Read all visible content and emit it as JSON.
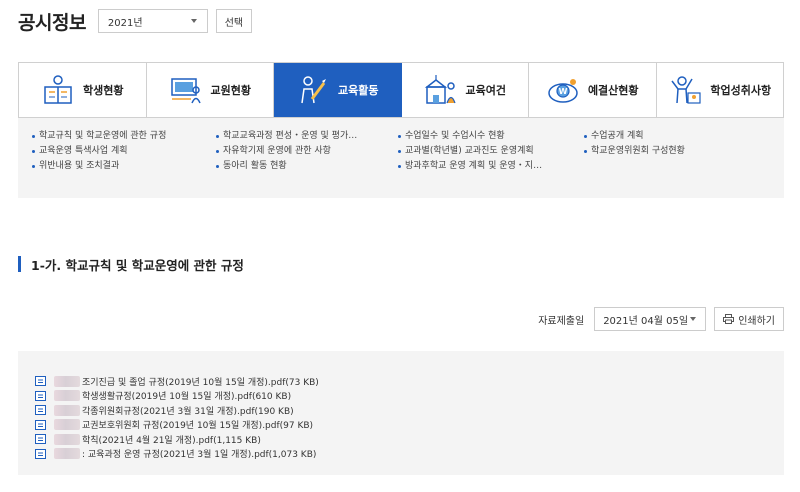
{
  "header": {
    "title": "공시정보",
    "year": "2021년",
    "select_button": "선택"
  },
  "tabs": [
    {
      "label": "학생현황",
      "icon": "students-icon",
      "active": false
    },
    {
      "label": "교원현황",
      "icon": "teacher-board-icon",
      "active": false
    },
    {
      "label": "교육활동",
      "icon": "activity-pencil-icon",
      "active": true
    },
    {
      "label": "교육여건",
      "icon": "school-building-icon",
      "active": false
    },
    {
      "label": "예결산현황",
      "icon": "budget-coin-icon",
      "active": false
    },
    {
      "label": "학업성취사항",
      "icon": "achievement-trophy-icon",
      "active": false
    }
  ],
  "submenu": {
    "col1": [
      "학교규칙 및 학교운영에 관한 규정",
      "교육운영 특색사업 계획",
      "위반내용 및 조치결과"
    ],
    "col2": [
      "학교교육과정 편성・운영 및 평가…",
      "자유학기제 운영에 관한 사항",
      "동아리 활동 현황"
    ],
    "col3": [
      "수업일수 및 수업시수 현황",
      "교과별(학년별) 교과진도 운영계획",
      "방과후학교 운영 계획 및 운영・지…"
    ],
    "col4": [
      "수업공개 계획",
      "학교운영위원회 구성현황"
    ]
  },
  "section": {
    "title": "1-가. 학교규칙 및 학교운영에 관한 규정",
    "date_label": "자료제출일",
    "date_value": "2021년 04월 05일",
    "print_label": "인쇄하기"
  },
  "files": [
    "조기진급 및 졸업 규정(2019년 10월 15일 개정).pdf(73 KB)",
    "학생생활규정(2019년 10월 15일 개정).pdf(610 KB)",
    "각종위원회규정(2021년 3월 31일 개정).pdf(190 KB)",
    "교권보호위원회 규정(2019년 10월 15일 개정).pdf(97 KB)",
    "학칙(2021년 4월 21일 개정).pdf(1,115 KB)",
    ": 교육과정 운영 규정(2021년 3월 1일 개정).pdf(1,073 KB)"
  ],
  "colors": {
    "accent": "#1f5fbf",
    "panel_bg": "#f4f4f4"
  }
}
